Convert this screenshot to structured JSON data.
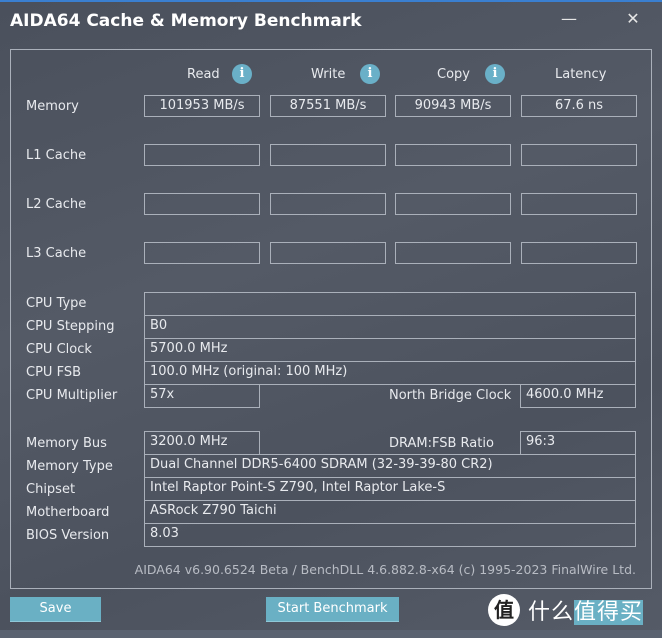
{
  "window": {
    "title": "AIDA64 Cache & Memory Benchmark",
    "minimize_icon": "minimize-icon",
    "close_icon": "close-icon"
  },
  "columns": [
    {
      "label": "Read",
      "info_icon": "i"
    },
    {
      "label": "Write",
      "info_icon": "i"
    },
    {
      "label": "Copy",
      "info_icon": "i"
    },
    {
      "label": "Latency"
    }
  ],
  "bench_rows": [
    {
      "label": "Memory",
      "read": "101953 MB/s",
      "write": "87551 MB/s",
      "copy": "90943 MB/s",
      "latency": "67.6 ns"
    },
    {
      "label": "L1 Cache",
      "read": "",
      "write": "",
      "copy": "",
      "latency": ""
    },
    {
      "label": "L2 Cache",
      "read": "",
      "write": "",
      "copy": "",
      "latency": ""
    },
    {
      "label": "L3 Cache",
      "read": "",
      "write": "",
      "copy": "",
      "latency": ""
    }
  ],
  "cpu": {
    "type_label": "CPU Type",
    "type_value": "",
    "stepping_label": "CPU Stepping",
    "stepping_value": "B0",
    "clock_label": "CPU Clock",
    "clock_value": "5700.0 MHz",
    "fsb_label": "CPU FSB",
    "fsb_value": "100.0 MHz  (original: 100 MHz)",
    "multiplier_label": "CPU Multiplier",
    "multiplier_value": "57x",
    "nb_clock_label": "North Bridge Clock",
    "nb_clock_value": "4600.0 MHz"
  },
  "memory": {
    "bus_label": "Memory Bus",
    "bus_value": "3200.0 MHz",
    "ratio_label": "DRAM:FSB Ratio",
    "ratio_value": "96:3",
    "type_label": "Memory Type",
    "type_value": "Dual Channel DDR5-6400 SDRAM  (32-39-39-80 CR2)",
    "chipset_label": "Chipset",
    "chipset_value": "Intel Raptor Point-S Z790, Intel Raptor Lake-S",
    "motherboard_label": "Motherboard",
    "motherboard_value": "ASRock Z790 Taichi",
    "bios_label": "BIOS Version",
    "bios_value": "8.03"
  },
  "footer": "AIDA64 v6.90.6524 Beta / BenchDLL 4.6.882.8-x64  (c) 1995-2023 FinalWire Ltd.",
  "buttons": {
    "save": "Save",
    "start": "Start Benchmark"
  },
  "watermark": {
    "logo": "值",
    "text_a": "什么",
    "text_b": "值得买"
  }
}
